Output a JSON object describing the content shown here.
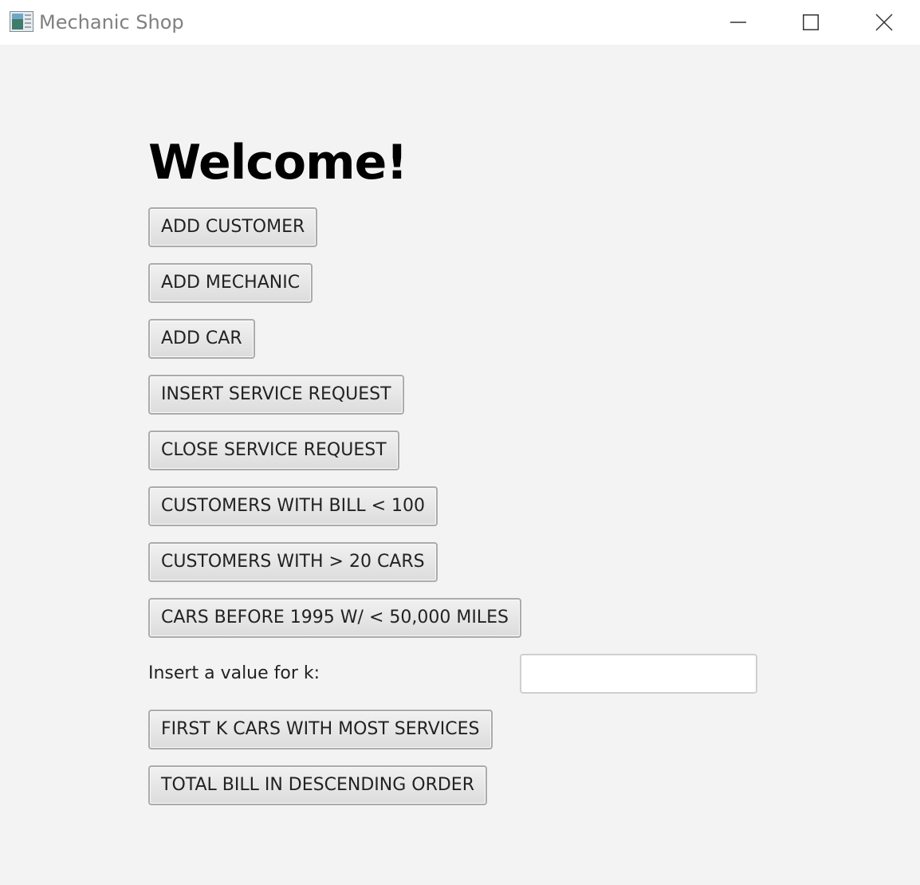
{
  "window": {
    "title": "Mechanic Shop",
    "icon": "app-icon",
    "controls": {
      "minimize_icon": "minimize-icon",
      "maximize_icon": "maximize-icon",
      "close_icon": "close-icon"
    }
  },
  "main": {
    "heading": "Welcome!",
    "buttons": {
      "add_customer": "ADD CUSTOMER",
      "add_mechanic": "ADD MECHANIC",
      "add_car": "ADD CAR",
      "insert_service_request": "INSERT SERVICE REQUEST",
      "close_service_request": "CLOSE SERVICE REQUEST",
      "customers_bill_lt_100": "CUSTOMERS WITH BILL < 100",
      "customers_gt_20_cars": "CUSTOMERS WITH > 20 CARS",
      "cars_before_1995": "CARS BEFORE 1995 W/ < 50,000 MILES",
      "first_k_cars": "FIRST K CARS WITH MOST SERVICES",
      "total_bill_desc": "TOTAL BILL IN DESCENDING ORDER"
    },
    "k_label": "Insert a value for k:",
    "k_value": "",
    "k_placeholder": ""
  },
  "colors": {
    "background": "#f3f3f3",
    "titlebar": "#ffffff",
    "title_text": "#808080",
    "button_border": "#ababab"
  }
}
